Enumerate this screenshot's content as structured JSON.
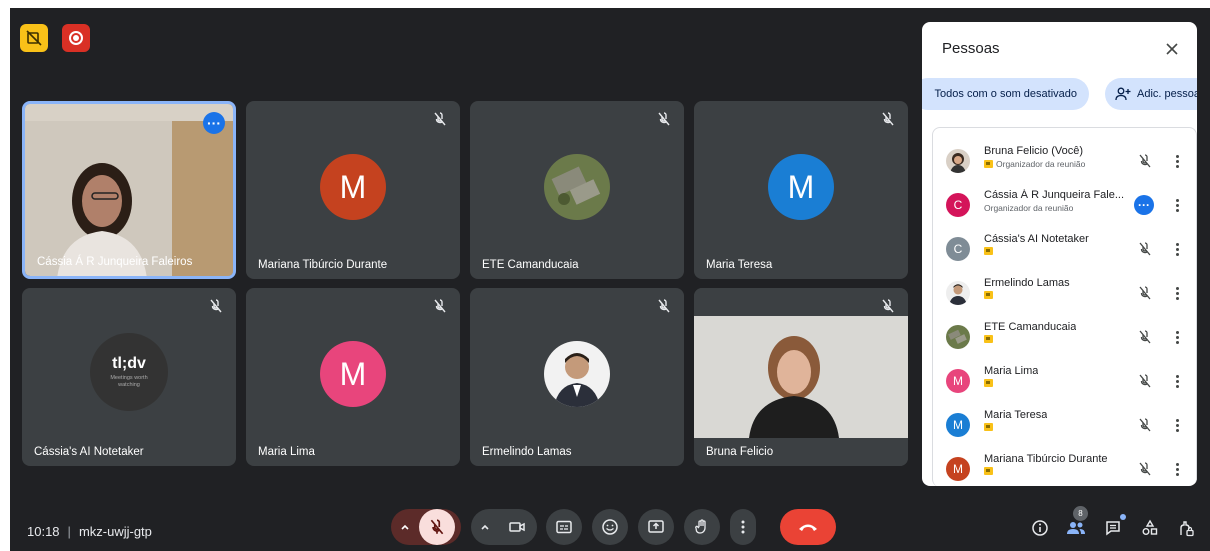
{
  "colors": {
    "background": "#202124",
    "tile": "#3c4043",
    "accent": "#8ab4f8",
    "leave": "#ea4335",
    "record": "#d93025",
    "hide_badge": "#f9c118"
  },
  "meeting": {
    "time": "10:18",
    "separator": "|",
    "code": "mkz-uwjj-gtp"
  },
  "tiles": [
    {
      "name": "Cássia Á R Junqueira Faleiros",
      "type": "video"
    },
    {
      "name": "Mariana Tibúrcio Durante",
      "type": "initial",
      "initial": "M",
      "color": "#c5421f"
    },
    {
      "name": "ETE Camanducaia",
      "type": "photo"
    },
    {
      "name": "Maria Teresa",
      "type": "initial",
      "initial": "M",
      "color": "#1a7ed4"
    },
    {
      "name": "Cássia's AI Notetaker",
      "type": "logo",
      "logo": "tl;dv",
      "logo_sub": "Meetings worth watching"
    },
    {
      "name": "Maria Lima",
      "type": "initial",
      "initial": "M",
      "color": "#e8457c"
    },
    {
      "name": "Ermelindo Lamas",
      "type": "photo"
    },
    {
      "name": "Bruna Felicio",
      "type": "video"
    }
  ],
  "panel": {
    "title": "Pessoas",
    "mute_all": "Todos com o som desativado",
    "add_people": "Adic. pessoas",
    "participants": [
      {
        "name": "Bruna Felicio (Você)",
        "role": "Organizador da reunião",
        "avatar": "photo"
      },
      {
        "name": "Cássia Á R Junqueira Fale...",
        "role": "Organizador da reunião",
        "avatar": "initial",
        "initial": "C",
        "color": "#d4145a"
      },
      {
        "name": "Cássia's AI Notetaker",
        "role": "",
        "avatar": "initial",
        "initial": "C",
        "color": "#7f8c96"
      },
      {
        "name": "Ermelindo Lamas",
        "role": "",
        "avatar": "photo"
      },
      {
        "name": "ETE Camanducaia",
        "role": "",
        "avatar": "photo"
      },
      {
        "name": "Maria Lima",
        "role": "",
        "avatar": "initial",
        "initial": "M",
        "color": "#e8457c"
      },
      {
        "name": "Maria Teresa",
        "role": "",
        "avatar": "initial",
        "initial": "M",
        "color": "#1a7ed4"
      },
      {
        "name": "Mariana Tibúrcio Durante",
        "role": "",
        "avatar": "initial",
        "initial": "M",
        "color": "#c5421f"
      }
    ]
  },
  "toolbar": {
    "people_count": "8"
  },
  "icons": {
    "hide_badge": "video-hidden-icon",
    "record": "record-icon",
    "mic": "mic-off-icon",
    "camera": "camera-icon",
    "captions": "captions-icon",
    "emoji": "emoji-icon",
    "present": "present-icon",
    "hand": "raise-hand-icon",
    "more": "more-vert-icon",
    "leave": "leave-call-icon",
    "info": "info-icon",
    "people": "people-icon",
    "chat": "chat-icon",
    "activities": "activities-icon",
    "host_controls": "host-controls-icon"
  }
}
